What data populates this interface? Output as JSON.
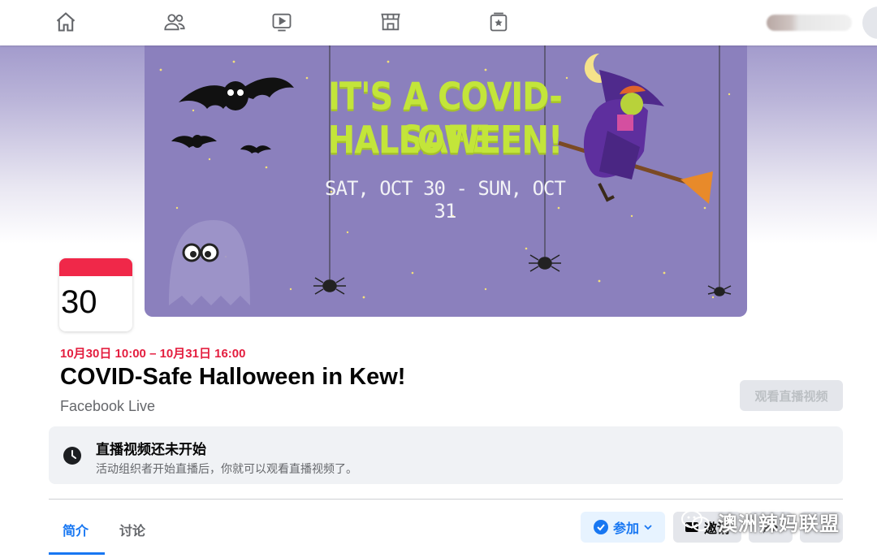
{
  "nav": {
    "items": [
      {
        "name": "home-icon"
      },
      {
        "name": "friends-icon"
      },
      {
        "name": "watch-icon"
      },
      {
        "name": "marketplace-icon"
      },
      {
        "name": "groups-icon"
      }
    ]
  },
  "cover": {
    "title_line1": "IT'S A COVID-SAFE",
    "title_line2": "HALLOWEEN!",
    "dates": "SAT, OCT 30 - SUN, OCT 31"
  },
  "calendar": {
    "day": "30"
  },
  "event": {
    "datetime": "10月30日 10:00 – 10月31日 16:00",
    "title": "COVID-Safe Halloween in Kew!",
    "host": "Facebook Live",
    "watch_live_label": "观看直播视频"
  },
  "notice": {
    "icon": "clock-icon",
    "title": "直播视频还未开始",
    "subtitle": "活动组织者开始直播后，你就可以观看直播视频了。"
  },
  "tabs": [
    {
      "label": "简介",
      "active": true
    },
    {
      "label": "讨论",
      "active": false
    }
  ],
  "actions": {
    "join_label": "参加",
    "invite_label": "邀请"
  },
  "watermark": {
    "text": "澳洲辣妈联盟"
  },
  "colors": {
    "accent": "#1877f2",
    "date_red": "#e41e3f",
    "calendar_red": "#f02849",
    "cover_purple": "#8b80bd",
    "cover_title_green": "#c3e53a"
  }
}
